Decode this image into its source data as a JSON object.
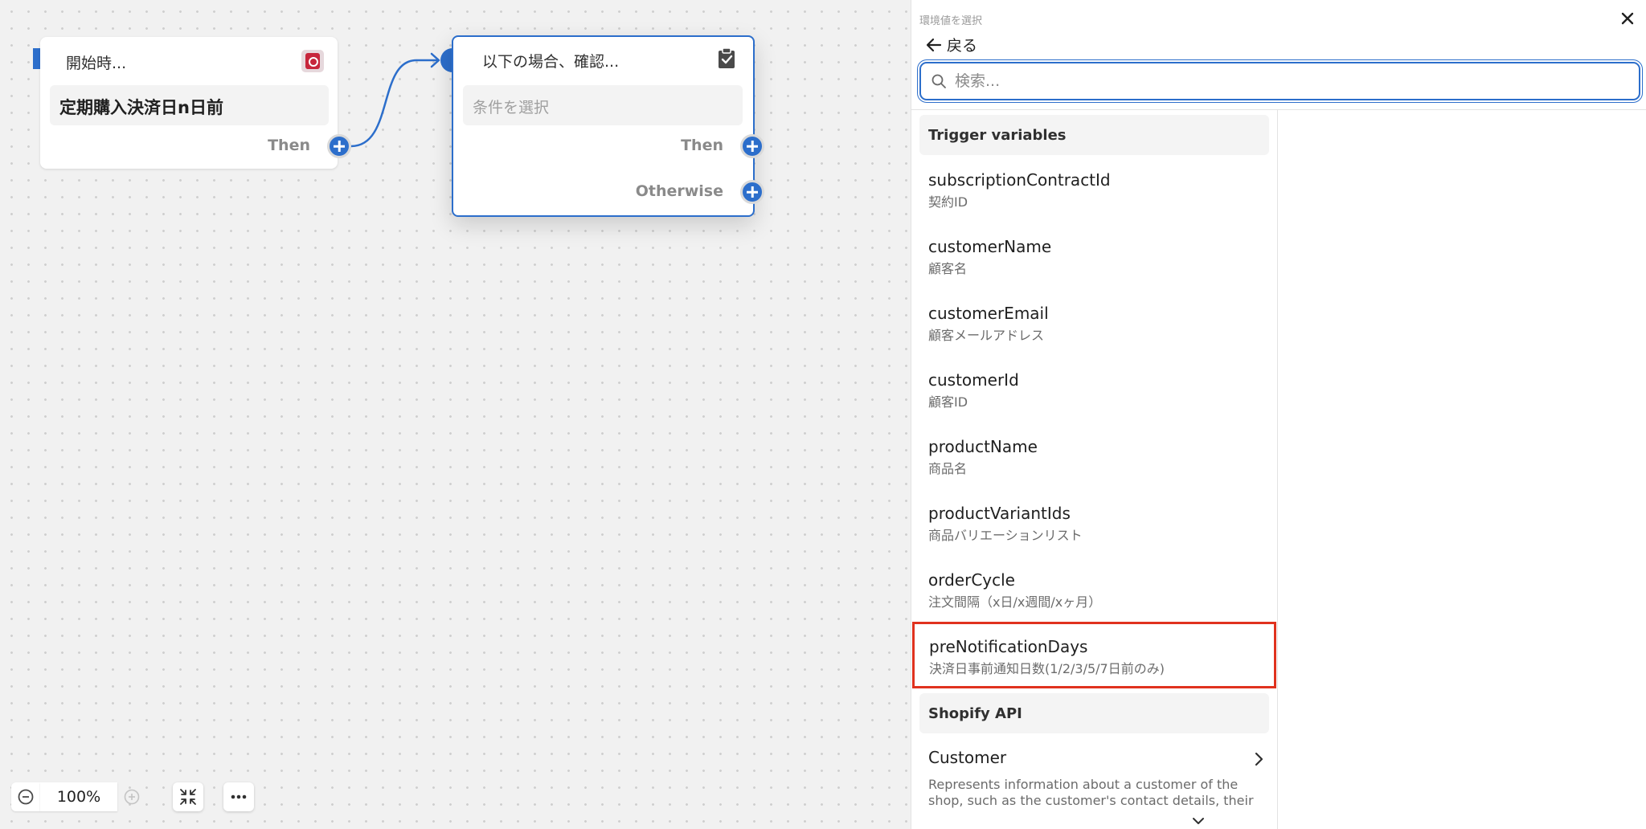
{
  "canvas": {
    "trigger_node": {
      "header": "開始時...",
      "event": "定期購入決済日n日前",
      "then_label": "Then",
      "icon": "shopify-bag-icon"
    },
    "condition_node": {
      "header": "以下の場合、確認...",
      "placeholder": "条件を選択",
      "then_label": "Then",
      "otherwise_label": "Otherwise",
      "icon": "clipboard-check-icon"
    },
    "zoom": {
      "level": "100%"
    }
  },
  "panel": {
    "title": "環境値を選択",
    "back_label": "戻る",
    "search_placeholder": "検索...",
    "trigger_section": "Trigger variables",
    "variables": [
      {
        "name": "subscriptionContractId",
        "desc": "契約ID"
      },
      {
        "name": "customerName",
        "desc": "顧客名"
      },
      {
        "name": "customerEmail",
        "desc": "顧客メールアドレス"
      },
      {
        "name": "customerId",
        "desc": "顧客ID"
      },
      {
        "name": "productName",
        "desc": "商品名"
      },
      {
        "name": "productVariantIds",
        "desc": "商品バリエーションリスト"
      },
      {
        "name": "orderCycle",
        "desc": "注文間隔（x日/x週間/xヶ月）"
      },
      {
        "name": "preNotificationDays",
        "desc": "決済日事前通知日数(1/2/3/5/7日前のみ)"
      }
    ],
    "api_section": "Shopify API",
    "api_items": [
      {
        "name": "Customer",
        "desc": "Represents information about a customer of the shop, such as the customer's contact details, their"
      }
    ]
  },
  "colors": {
    "accent": "#2c6ecb",
    "highlight": "#e0321e",
    "shopify_red": "#c7263c"
  }
}
